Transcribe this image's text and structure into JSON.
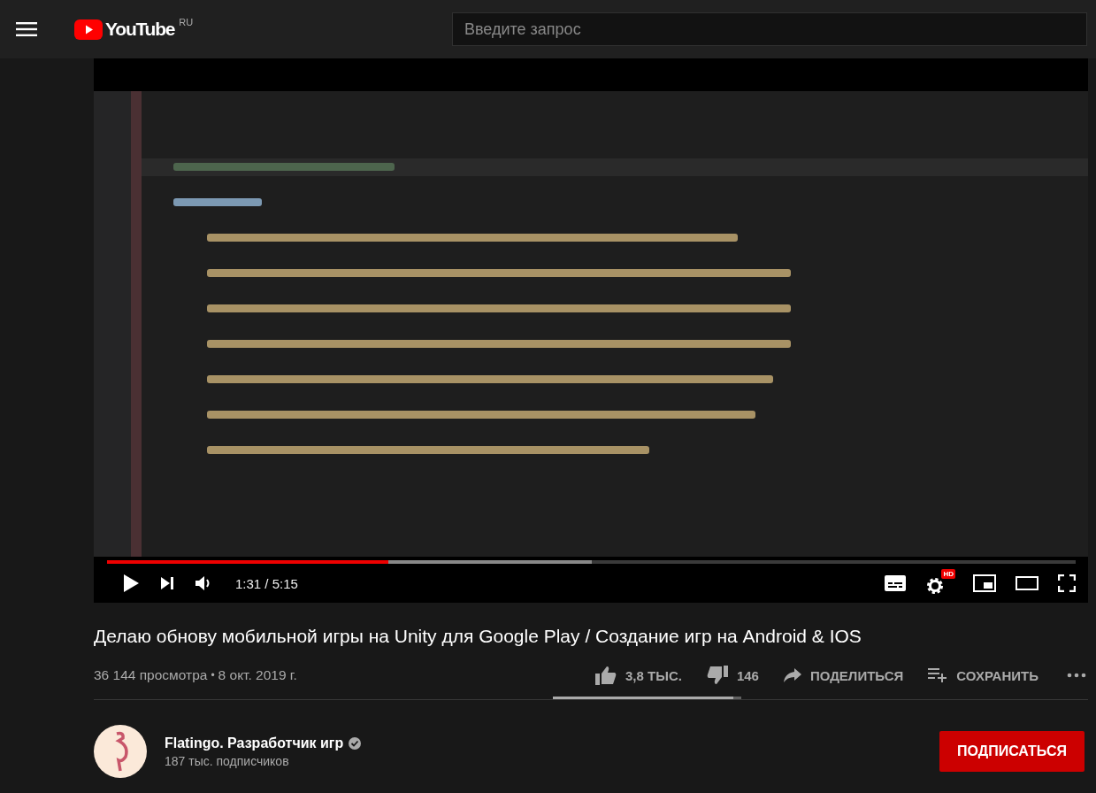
{
  "header": {
    "logo": "YouTube",
    "region": "RU",
    "search": {
      "placeholder": "Введите запрос"
    }
  },
  "player": {
    "progress": {
      "level": 0.29,
      "buffer": {
        "level": 0.5
      }
    },
    "time": "1:31 / 5:15",
    "settings_badge": "HD"
  },
  "video": {
    "title": "Делаю обнову мобильной игры на Unity для Google Play / Создание игр на Android & IOS",
    "views": "36 144 просмотра",
    "separator": "•",
    "date": "8 окт. 2019 г.",
    "actions": [
      {
        "kind": "like",
        "label": "3,8 ТЫС."
      },
      {
        "kind": "dislike",
        "label": "146"
      },
      {
        "kind": "share",
        "label": "ПОДЕЛИТЬСЯ"
      },
      {
        "kind": "save",
        "label": "СОХРАНИТЬ"
      },
      {
        "kind": "more"
      }
    ],
    "sentiment": {
      "level": 0.96
    }
  },
  "channel": {
    "name": "Flatingo. Разработчик игр",
    "verified": true,
    "subscribers": "187 тыс. подписчиков",
    "subscribe": "ПОДПИСАТЬСЯ"
  }
}
